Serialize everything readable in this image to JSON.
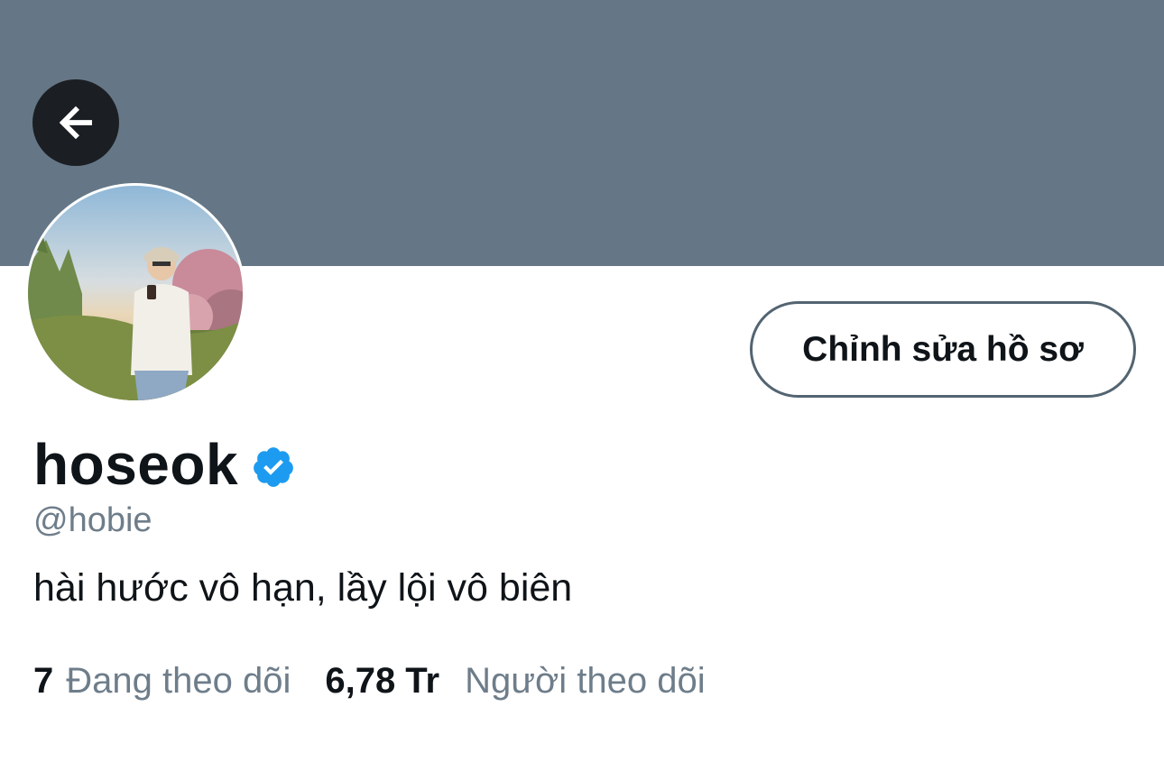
{
  "header": {
    "back_icon": "arrow-left-icon",
    "banner_color": "#657786"
  },
  "profile": {
    "edit_button_label": "Chỉnh sửa hồ sơ",
    "display_name": "hoseok",
    "verified_icon": "verified-badge-icon",
    "verified_color": "#1d9bf0",
    "handle": "@hobie",
    "bio": "hài hước vô hạn, lầy lội vô biên"
  },
  "stats": {
    "following_count": "7",
    "following_label": "Đang theo dõi",
    "followers_count": "6,78 Tr",
    "followers_label": "Người theo dõi"
  }
}
